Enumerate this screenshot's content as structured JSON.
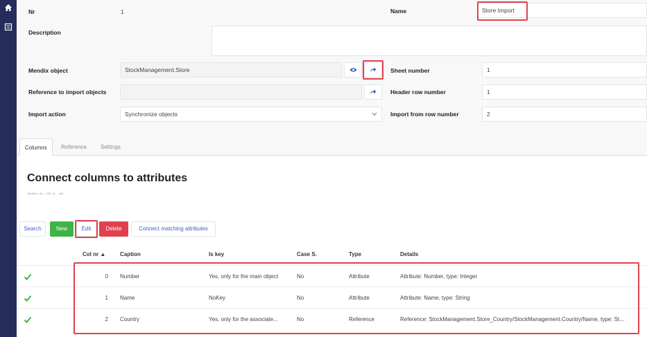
{
  "nav": {
    "items": [
      {
        "icon": "home-icon"
      },
      {
        "icon": "list-icon"
      }
    ]
  },
  "form": {
    "nr_label": "Nr",
    "nr_value": "1",
    "name_label": "Name",
    "name_value": "Store Import",
    "description_label": "Description",
    "description_value": "",
    "mendix_label": "Mendix object",
    "mendix_value": "StockManagement.Store",
    "reference_label": "Reference to import objects",
    "reference_value": "",
    "import_action_label": "Import action",
    "import_action_value": "Synchronize objects",
    "sheet_number_label": "Sheet number",
    "sheet_number_value": "1",
    "header_row_label": "Header row number",
    "header_row_value": "1",
    "import_from_label": "Import from row number",
    "import_from_value": "2"
  },
  "tabs": [
    "Columns",
    "Reference",
    "Settings"
  ],
  "section": {
    "title": "Connect columns to attributes",
    "subtitle": "Col Nr 0 = A, ... 25 = Z, ... etc"
  },
  "toolbar": {
    "search": "Search",
    "new": "New",
    "edit": "Edit",
    "delete": "Delete",
    "connect": "Connect matching attributes"
  },
  "table": {
    "headers": [
      "Col nr ▲",
      "Caption",
      "Is key",
      "Case S.",
      "Type",
      "Details"
    ],
    "rows": [
      {
        "col": "0",
        "caption": "Number",
        "is_key": "Yes, only for the main object",
        "case": "No",
        "type": "Attribute",
        "details": "Attribute: Number, type: Integer"
      },
      {
        "col": "1",
        "caption": "Name",
        "is_key": "NoKey",
        "case": "No",
        "type": "Attribute",
        "details": "Attribute: Name, type: String"
      },
      {
        "col": "2",
        "caption": "Country",
        "is_key": "Yes, only for the associate...",
        "case": "No",
        "type": "Reference",
        "details": "Reference: StockManagement.Store_Country/StockManagement.Country/Name, type: St..."
      }
    ]
  },
  "colors": {
    "sidebar": "#252c5c",
    "accent": "#3f5fc4",
    "success": "#3fb344",
    "danger": "#e0414d",
    "highlight": "#e0414d"
  }
}
